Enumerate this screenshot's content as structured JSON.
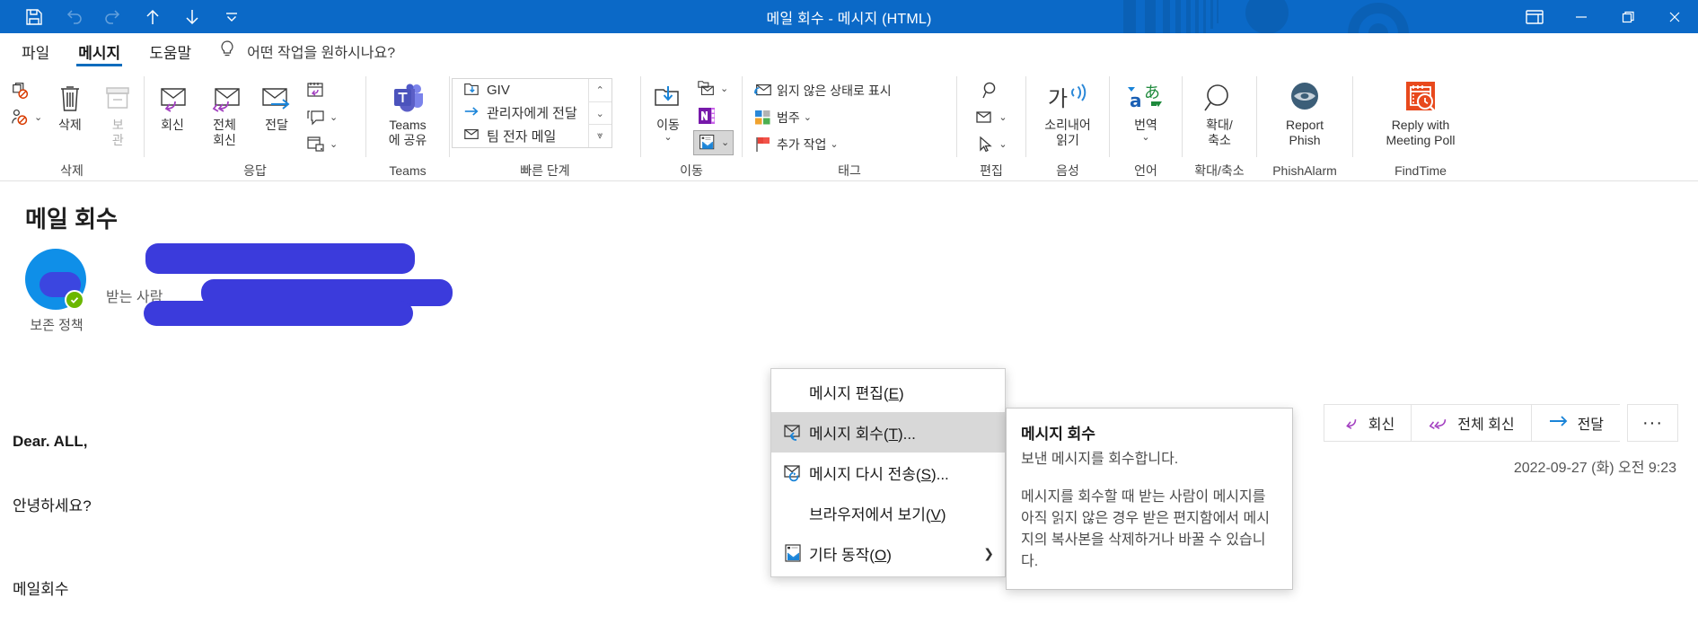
{
  "window": {
    "title": "메일 회수  -  메시지 (HTML)",
    "accent_color": "#0b69c7",
    "quick_access": [
      {
        "name": "save-icon",
        "label": "저장"
      },
      {
        "name": "undo-icon",
        "label": "실행 취소"
      },
      {
        "name": "redo-icon",
        "label": "다시 실행"
      },
      {
        "name": "previous-item-icon",
        "label": "이전 항목"
      },
      {
        "name": "next-item-icon",
        "label": "다음 항목"
      },
      {
        "name": "customize-qat-icon",
        "label": "빠른 실행 도구 모음 사용자 지정"
      }
    ],
    "controls": {
      "ribbon_display": "리본 표시 옵션",
      "minimize": "최소화",
      "restore": "이전 크기로 복원",
      "close": "닫기"
    }
  },
  "tabs": [
    {
      "label": "파일",
      "active": false
    },
    {
      "label": "메시지",
      "active": true
    },
    {
      "label": "도움말",
      "active": false
    }
  ],
  "tellme": {
    "icon": "lightbulb-icon",
    "text": "어떤 작업을 원하시나요?"
  },
  "ribbon": {
    "groups": [
      {
        "label": "삭제",
        "small_buttons": [
          {
            "label": "",
            "icon": "ignore-icon"
          },
          {
            "label": "",
            "icon": "block-sender-icon",
            "chevron": true
          }
        ],
        "big_buttons": [
          {
            "label": "삭제",
            "icon": "delete-trash-icon",
            "disabled": false
          },
          {
            "label": "보\n관",
            "icon": "archive-icon",
            "disabled": true
          }
        ]
      },
      {
        "label": "응답",
        "big_buttons": [
          {
            "label": "회신",
            "icon": "reply-icon"
          },
          {
            "label": "전체\n회신",
            "icon": "reply-all-icon"
          },
          {
            "label": "전달",
            "icon": "forward-icon"
          }
        ],
        "small_buttons": [
          {
            "label": "",
            "icon": "meeting-reply-icon"
          },
          {
            "label": "",
            "icon": "im-reply-icon",
            "chevron": true
          },
          {
            "label": "",
            "icon": "more-respond-icon",
            "chevron": true
          }
        ]
      },
      {
        "label": "Teams",
        "big_buttons": [
          {
            "label": "Teams\n에 공유",
            "icon": "teams-icon"
          }
        ]
      },
      {
        "label": "빠른 단계",
        "quick_steps": [
          {
            "label": "GIV",
            "icon": "move-to-folder-icon"
          },
          {
            "label": "관리자에게 전달",
            "icon": "forward-arrow-icon"
          },
          {
            "label": "팀 전자 메일",
            "icon": "team-email-icon"
          }
        ],
        "scroll": [
          "▲",
          "▼",
          "▼▬"
        ],
        "has_dialog_launcher": true
      },
      {
        "label": "이동",
        "big_buttons": [
          {
            "label": "이동",
            "icon": "move-icon",
            "chevron": true
          }
        ],
        "small_buttons": [
          {
            "label": "",
            "icon": "rules-icon",
            "chevron": true
          },
          {
            "label": "",
            "icon": "onenote-icon"
          },
          {
            "label": "",
            "icon": "actions-icon",
            "chevron": true,
            "active": true
          }
        ]
      },
      {
        "label": "태그",
        "small_buttons": [
          {
            "label": "읽지 않은 상태로 표시",
            "icon": "mark-unread-icon"
          },
          {
            "label": "범주",
            "icon": "categorize-icon",
            "chevron": true
          },
          {
            "label": "추가 작업",
            "icon": "follow-up-flag-icon",
            "chevron": true
          }
        ],
        "has_dialog_launcher": true
      },
      {
        "label": "편집",
        "small_buttons": [
          {
            "label": "",
            "icon": "find-icon"
          },
          {
            "label": "",
            "icon": "related-icon",
            "chevron": true
          },
          {
            "label": "",
            "icon": "select-icon",
            "chevron": true
          }
        ]
      },
      {
        "label": "음성",
        "big_buttons": [
          {
            "label": "소리내어\n읽기",
            "icon": "read-aloud-icon"
          }
        ]
      },
      {
        "label": "언어",
        "big_buttons": [
          {
            "label": "번역",
            "icon": "translate-icon",
            "chevron": true
          }
        ]
      },
      {
        "label": "확대/축소",
        "big_buttons": [
          {
            "label": "확대/\n축소",
            "icon": "zoom-icon"
          }
        ]
      },
      {
        "label": "PhishAlarm",
        "big_buttons": [
          {
            "label": "Report\nPhish",
            "icon": "phishalarm-icon"
          }
        ]
      },
      {
        "label": "FindTime",
        "big_buttons": [
          {
            "label": "Reply with\nMeeting Poll",
            "icon": "findtime-icon"
          }
        ]
      }
    ],
    "collapse_icon": "collapse-ribbon-icon"
  },
  "message": {
    "subject": "메일 회수",
    "retention_label": "보존 정책",
    "to_label": "받는 사람",
    "sender_redacted": true,
    "recipients_redacted": true,
    "timestamp": "2022-09-27 (화) 오전 9:23",
    "actions": [
      {
        "label": "회신",
        "icon": "reply-icon"
      },
      {
        "label": "전체 회신",
        "icon": "reply-all-icon"
      },
      {
        "label": "전달",
        "icon": "forward-arrow-icon"
      },
      {
        "label": "···",
        "icon": "more-actions-icon"
      }
    ],
    "body_lines": [
      {
        "text": "Dear. ALL,",
        "bold": true
      },
      {
        "text": "",
        "bold": false
      },
      {
        "text": "안녕하세요?",
        "bold": false
      },
      {
        "text": "",
        "bold": false
      },
      {
        "text": "",
        "bold": false
      },
      {
        "text": "메일회수",
        "bold": false
      }
    ]
  },
  "context_menu": {
    "items": [
      {
        "label": "메시지 편집(",
        "accel": "E",
        "tail": ")",
        "icon": null,
        "selected": false,
        "submenu": false
      },
      {
        "label": "메시지 회수(",
        "accel": "T",
        "tail": ")...",
        "icon": "recall-message-icon",
        "selected": true,
        "submenu": false
      },
      {
        "label": "메시지 다시 전송(",
        "accel": "S",
        "tail": ")...",
        "icon": "resend-message-icon",
        "selected": false,
        "submenu": false
      },
      {
        "label": "브라우저에서 보기(",
        "accel": "V",
        "tail": ")",
        "icon": null,
        "selected": false,
        "submenu": false
      },
      {
        "label": "기타 동작(",
        "accel": "O",
        "tail": ")",
        "icon": "other-actions-icon",
        "selected": false,
        "submenu": true
      }
    ]
  },
  "tooltip": {
    "title": "메시지 회수",
    "line1": "보낸 메시지를 회수합니다.",
    "line2": "메시지를 회수할 때 받는 사람이 메시지를 아직 읽지 않은 경우 받은 편지함에서 메시지의 복사본을 삭제하거나 바꿀 수 있습니다."
  }
}
